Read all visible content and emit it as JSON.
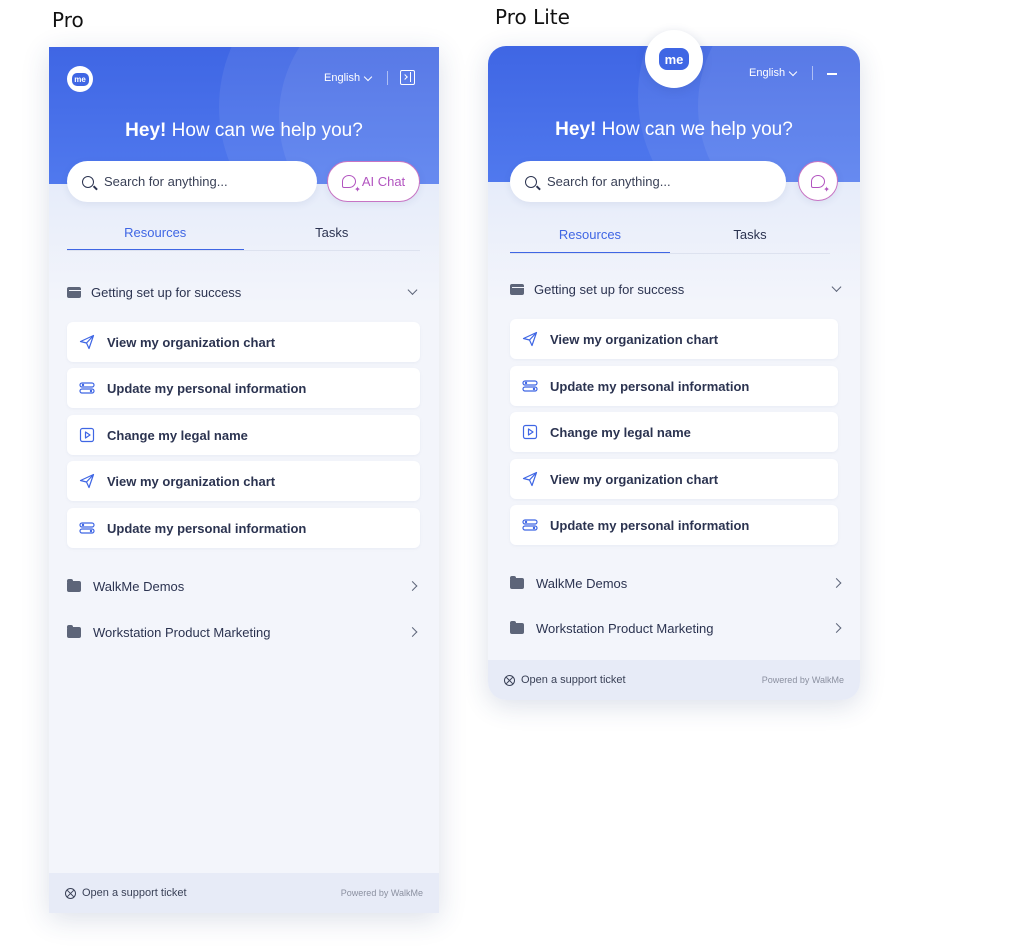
{
  "labels": {
    "pro": "Pro",
    "lite": "Pro Lite"
  },
  "logo_text": "me",
  "header": {
    "language": "English",
    "greeting_bold": "Hey!",
    "greeting_rest": " How can we help you?"
  },
  "search": {
    "placeholder": "Search for anything..."
  },
  "ai_chat": {
    "label": "AI Chat"
  },
  "tabs": [
    {
      "label": "Resources",
      "active": true
    },
    {
      "label": "Tasks",
      "active": false
    }
  ],
  "group": {
    "title": "Getting set up for success",
    "expanded": true
  },
  "items": [
    {
      "label": "View my organization chart",
      "icon": "paper-plane-icon"
    },
    {
      "label": "Update my personal information",
      "icon": "toggles-icon"
    },
    {
      "label": "Change my legal name",
      "icon": "video-play-icon"
    },
    {
      "label": "View my organization chart",
      "icon": "paper-plane-icon"
    },
    {
      "label": "Update my personal information",
      "icon": "toggles-icon"
    }
  ],
  "folders": [
    {
      "label": "WalkMe Demos"
    },
    {
      "label": "Workstation Product Marketing"
    }
  ],
  "footer": {
    "support": "Open a support ticket",
    "powered": "Powered by WalkMe"
  },
  "colors": {
    "brand": "#3f66e4",
    "ai_accent": "#b254c0",
    "background": "#f3f5fb"
  }
}
